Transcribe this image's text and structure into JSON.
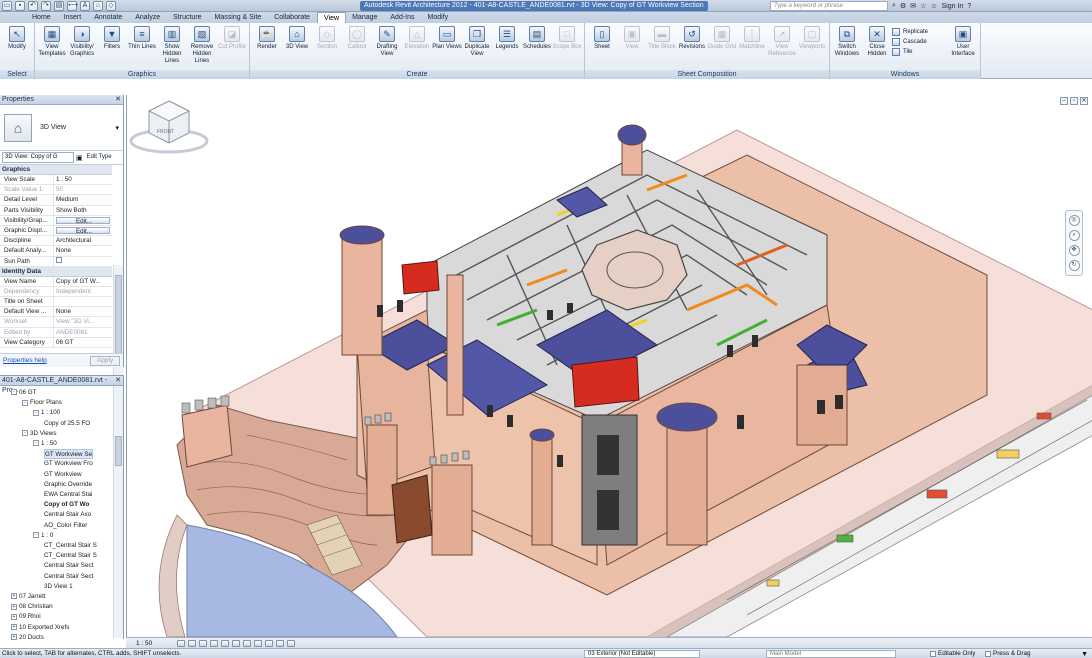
{
  "titlebar": {
    "title": "Autodesk Revit Architecture 2012 -   401-A8-CASTLE_ANDE0081.rvt - 3D View: Copy of GT Workview Section",
    "search_placeholder": "Type a keyword or phrase",
    "sign_in": "Sign In"
  },
  "app_button": "R",
  "tabs": [
    "Home",
    "Insert",
    "Annotate",
    "Analyze",
    "Structure",
    "Massing & Site",
    "Collaborate",
    "View",
    "Manage",
    "Add-Ins",
    "Modify"
  ],
  "active_tab": "View",
  "ribbon": {
    "select": {
      "label": "Select",
      "buttons": [
        {
          "label": "Modify",
          "icon": "cursor-icon"
        }
      ]
    },
    "graphics": {
      "label": "Graphics",
      "buttons": [
        {
          "label": "View Templates",
          "icon": "view-templates-icon"
        },
        {
          "label": "Visibility/ Graphics",
          "icon": "visibility-icon"
        },
        {
          "label": "Filters",
          "icon": "filter-icon"
        },
        {
          "label": "Thin Lines",
          "icon": "thin-lines-icon"
        },
        {
          "label": "Show Hidden Lines",
          "icon": "show-hidden-icon"
        },
        {
          "label": "Remove Hidden Lines",
          "icon": "remove-hidden-icon"
        },
        {
          "label": "Cut Profile",
          "icon": "cut-profile-icon",
          "disabled": true
        }
      ]
    },
    "create": {
      "label": "Create",
      "buttons": [
        {
          "label": "Render",
          "icon": "teapot-icon"
        },
        {
          "label": "3D View",
          "icon": "house-3d-icon"
        },
        {
          "label": "Section",
          "icon": "section-icon",
          "disabled": true
        },
        {
          "label": "Callout",
          "icon": "callout-icon",
          "disabled": true
        },
        {
          "label": "Drafting View",
          "icon": "drafting-icon"
        },
        {
          "label": "Elevation",
          "icon": "elevation-icon",
          "disabled": true
        },
        {
          "label": "Plan Views",
          "icon": "plan-views-icon"
        },
        {
          "label": "Duplicate View",
          "icon": "duplicate-icon"
        },
        {
          "label": "Legends",
          "icon": "legends-icon"
        },
        {
          "label": "Schedules",
          "icon": "schedules-icon"
        },
        {
          "label": "Scope Box",
          "icon": "scope-box-icon",
          "disabled": true
        }
      ]
    },
    "sheet": {
      "label": "Sheet Composition",
      "buttons": [
        {
          "label": "Sheet",
          "icon": "sheet-icon"
        },
        {
          "label": "View",
          "icon": "view-icon",
          "disabled": true
        },
        {
          "label": "Title Block",
          "icon": "title-block-icon",
          "disabled": true
        },
        {
          "label": "Revisions",
          "icon": "revisions-icon"
        },
        {
          "label": "Guide Grid",
          "icon": "guide-grid-icon",
          "disabled": true
        },
        {
          "label": "Matchline",
          "icon": "matchline-icon",
          "disabled": true
        },
        {
          "label": "View Reference",
          "icon": "view-reference-icon",
          "disabled": true
        },
        {
          "label": "Viewports",
          "icon": "viewports-icon",
          "disabled": true
        }
      ]
    },
    "windows": {
      "label": "Windows",
      "buttons": [
        {
          "label": "Switch Windows",
          "icon": "switch-windows-icon"
        },
        {
          "label": "Close Hidden",
          "icon": "close-hidden-icon"
        }
      ],
      "small": [
        {
          "label": "Replicate",
          "icon": "replicate-icon"
        },
        {
          "label": "Cascade",
          "icon": "cascade-icon"
        },
        {
          "label": "Tile",
          "icon": "tile-icon"
        }
      ],
      "ui_button": {
        "label": "User Interface",
        "icon": "user-interface-icon"
      }
    }
  },
  "properties": {
    "header": "Properties",
    "type_name": "3D View",
    "instance_selector": "3D View: Copy of G",
    "edit_type": "Edit Type",
    "groups": [
      {
        "name": "Graphics",
        "rows": [
          {
            "k": "View Scale",
            "v": "1 : 50"
          },
          {
            "k": "Scale Value   1:",
            "v": "50",
            "grey": true
          },
          {
            "k": "Detail Level",
            "v": "Medium"
          },
          {
            "k": "Parts Visibility",
            "v": "Show Both"
          },
          {
            "k": "Visibility/Grap...",
            "v": "Edit...",
            "button": true
          },
          {
            "k": "Graphic Displ...",
            "v": "Edit...",
            "button": true
          },
          {
            "k": "Discipline",
            "v": "Architectural"
          },
          {
            "k": "Default Analy...",
            "v": "None"
          },
          {
            "k": "Sun Path",
            "v": ""
          }
        ]
      },
      {
        "name": "Identity Data",
        "rows": [
          {
            "k": "View Name",
            "v": "Copy of GT W..."
          },
          {
            "k": "Dependency",
            "v": "Independent",
            "grey": true
          },
          {
            "k": "Title on Sheet",
            "v": ""
          },
          {
            "k": "Default View ...",
            "v": "None"
          },
          {
            "k": "Workset",
            "v": "View \"3D Vi...",
            "grey": true
          },
          {
            "k": "Edited by",
            "v": "ANDE0081",
            "grey": true
          },
          {
            "k": "View Category",
            "v": "06 GT"
          }
        ]
      }
    ],
    "help": "Properties help",
    "apply": "Apply"
  },
  "browser": {
    "header": "401-A8-CASTLE_ANDE0081.rvt - Pro...",
    "items": [
      {
        "label": "06 GT",
        "indent": 1,
        "tog": "-"
      },
      {
        "label": "Floor Plans",
        "indent": 2,
        "tog": "-"
      },
      {
        "label": "1 : 100",
        "indent": 3,
        "tog": "-"
      },
      {
        "label": "Copy of 25.5 FO",
        "indent": 4
      },
      {
        "label": "3D Views",
        "indent": 2,
        "tog": "-"
      },
      {
        "label": "1 : 50",
        "indent": 3,
        "tog": "-"
      },
      {
        "label": "GT Workview Se",
        "indent": 4,
        "sel": true
      },
      {
        "label": "GT Workview Fro",
        "indent": 4
      },
      {
        "label": "GT Workview",
        "indent": 4
      },
      {
        "label": "Graphic Override",
        "indent": 4
      },
      {
        "label": "EWA Central Stai",
        "indent": 4
      },
      {
        "label": "Copy of GT Wo",
        "indent": 4,
        "bold": true
      },
      {
        "label": "Central Stair Axo",
        "indent": 4
      },
      {
        "label": "AO_Color Filter",
        "indent": 4
      },
      {
        "label": "1 : 0",
        "indent": 3,
        "tog": "-"
      },
      {
        "label": "CT_Central Stair S",
        "indent": 4
      },
      {
        "label": "CT_Central Stair S",
        "indent": 4
      },
      {
        "label": "Central Stair Sect",
        "indent": 4
      },
      {
        "label": "Central Stair Sect",
        "indent": 4
      },
      {
        "label": "3D View 1",
        "indent": 4
      },
      {
        "label": "07 Jarrett",
        "indent": 1,
        "tog": "+"
      },
      {
        "label": "08 Christian",
        "indent": 1,
        "tog": "+"
      },
      {
        "label": "09 Rhoi",
        "indent": 1,
        "tog": "+"
      },
      {
        "label": "10 Exported Xrefs",
        "indent": 1,
        "tog": "+"
      },
      {
        "label": "20 Ducts",
        "indent": 1,
        "tog": "+"
      }
    ]
  },
  "viewcube": {
    "face": "FRONT"
  },
  "view_control": {
    "scale": "1 : 50"
  },
  "status": {
    "message": "Click to select, TAB for alternates, CTRL adds, SHIFT unselects.",
    "workset": "03 Exterior (Not Editable)",
    "design_option": "Main Model",
    "editable_only": "Editable Only",
    "press_drag": "Press & Drag"
  },
  "colors": {
    "accent": "#4d77b6",
    "ribbon_bg": "#e3eaf3",
    "base_pink": "#f6ddd8",
    "wall": "#e9b79e",
    "roof": "#4a4f9c"
  }
}
